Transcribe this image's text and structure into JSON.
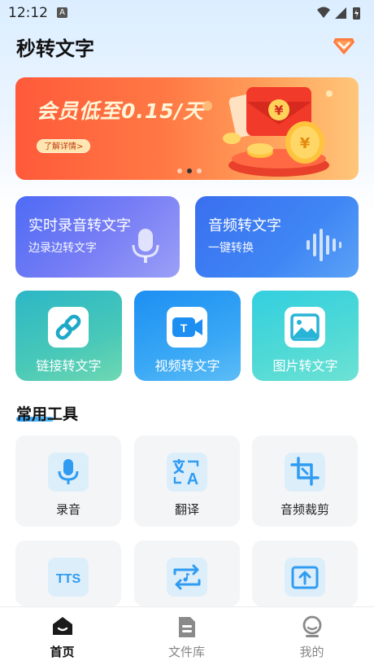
{
  "status_bar": {
    "time": "12:12",
    "input_badge": "A"
  },
  "app": {
    "title": "秒转文字"
  },
  "banner": {
    "headline": "会员低至0.15/天",
    "button": "了解详情>",
    "coin_symbol": "¥"
  },
  "feature_cards": {
    "realtime": {
      "title": "实时录音转文字",
      "subtitle": "边录边转文字"
    },
    "audio": {
      "title": "音频转文字",
      "subtitle": "一键转换"
    }
  },
  "convert_cards": [
    {
      "label": "链接转文字",
      "icon": "link-icon"
    },
    {
      "label": "视频转文字",
      "icon": "video-camera-icon"
    },
    {
      "label": "图片转文字",
      "icon": "image-icon"
    }
  ],
  "tools": {
    "section_title": "常用工具",
    "items": [
      {
        "label": "录音",
        "icon": "microphone-icon"
      },
      {
        "label": "翻译",
        "icon": "translate-icon"
      },
      {
        "label": "音频裁剪",
        "icon": "crop-icon"
      },
      {
        "label": "",
        "icon": "tts-icon",
        "icon_text": "TTS"
      },
      {
        "label": "",
        "icon": "audio-convert-icon"
      },
      {
        "label": "",
        "icon": "upload-icon"
      }
    ]
  },
  "tabbar": {
    "items": [
      {
        "label": "首页",
        "icon": "home-icon",
        "active": true
      },
      {
        "label": "文件库",
        "icon": "document-icon",
        "active": false
      },
      {
        "label": "我的",
        "icon": "profile-icon",
        "active": false
      }
    ]
  },
  "colors": {
    "accent": "#2f9cf2",
    "icon_bg": "#ddeefb",
    "banner_orange": "#ff5a3a"
  }
}
